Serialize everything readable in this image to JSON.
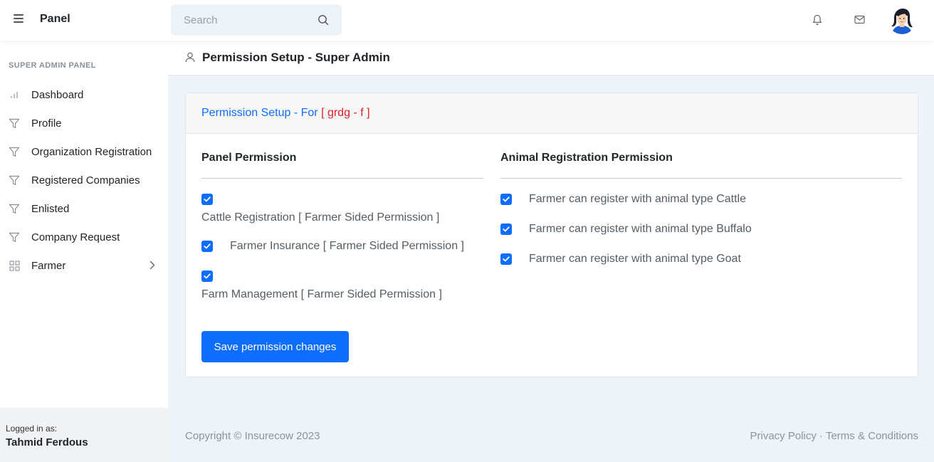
{
  "topnav": {
    "brand": "Panel",
    "search_placeholder": "Search",
    "icons": [
      "menu-icon",
      "search-icon",
      "bell-icon",
      "mail-icon"
    ]
  },
  "sidebar": {
    "title": "SUPER ADMIN PANEL",
    "items": [
      {
        "label": "Dashboard",
        "icon": "bar-chart-icon"
      },
      {
        "label": "Profile",
        "icon": "filter-icon"
      },
      {
        "label": "Organization Registration",
        "icon": "filter-icon"
      },
      {
        "label": "Registered Companies",
        "icon": "filter-icon"
      },
      {
        "label": "Enlisted",
        "icon": "filter-icon"
      },
      {
        "label": "Company Request",
        "icon": "filter-icon"
      },
      {
        "label": "Farmer",
        "icon": "grid-icon"
      }
    ],
    "logged_in_label": "Logged in as:",
    "logged_in_user": "Tahmid Ferdous"
  },
  "page": {
    "title": "Permission Setup - Super Admin"
  },
  "card": {
    "title_prefix": "Permission Setup - For",
    "title_target": "[ grdg - f ]",
    "panel_permission": {
      "title": "Panel Permission",
      "items": [
        {
          "label": "Cattle Registration [ Farmer Sided Permission ]",
          "checked": true
        },
        {
          "label": "Farmer Insurance [ Farmer Sided Permission ]",
          "checked": true
        },
        {
          "label": "Farm Management [ Farmer Sided Permission ]",
          "checked": true
        }
      ]
    },
    "animal_permission": {
      "title": "Animal Registration Permission",
      "items": [
        {
          "label": "Farmer can register with animal type Cattle",
          "checked": true
        },
        {
          "label": "Farmer can register with animal type Buffalo",
          "checked": true
        },
        {
          "label": "Farmer can register with animal type Goat",
          "checked": true
        }
      ]
    },
    "save_label": "Save permission changes"
  },
  "footer": {
    "copyright": "Copyright © Insurecow 2023",
    "privacy": "Privacy Policy",
    "separator": "·",
    "terms": "Terms & Conditions"
  },
  "colors": {
    "accent": "#0d6efd",
    "highlight": "#e51c23",
    "page_bg": "#eef2f9"
  }
}
